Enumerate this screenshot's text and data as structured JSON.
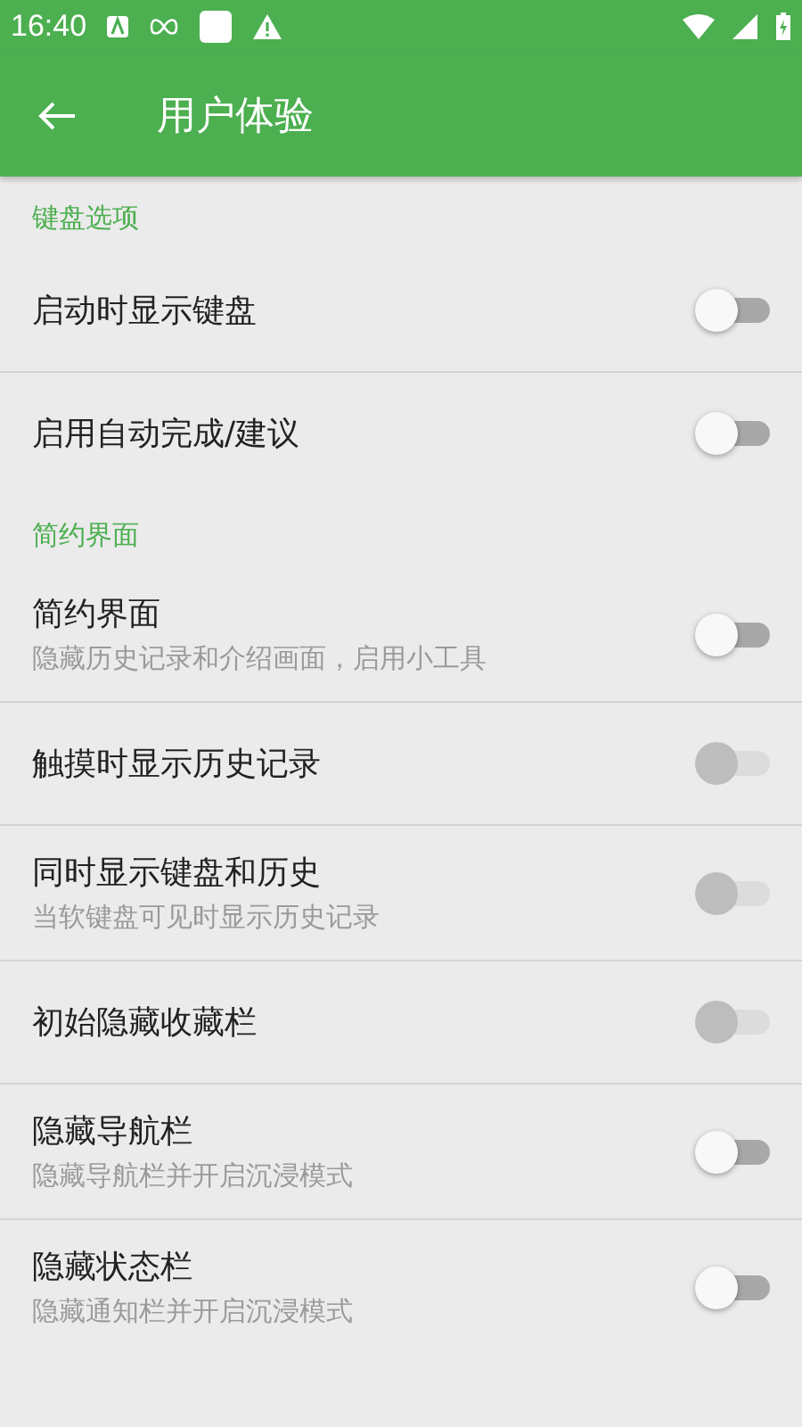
{
  "status_bar": {
    "time": "16:40"
  },
  "toolbar": {
    "title": "用户体验"
  },
  "sections": [
    {
      "header": "键盘选项",
      "items": [
        {
          "title": "启动时显示键盘",
          "on": false,
          "disabled": false
        },
        {
          "title": "启用自动完成/建议",
          "on": false,
          "disabled": false
        }
      ]
    },
    {
      "header": "简约界面",
      "items": [
        {
          "title": "简约界面",
          "summary": "隐藏历史记录和介绍画面，启用小工具",
          "on": false,
          "disabled": false
        },
        {
          "title": "触摸时显示历史记录",
          "on": false,
          "disabled": true
        },
        {
          "title": "同时显示键盘和历史",
          "summary": "当软键盘可见时显示历史记录",
          "on": false,
          "disabled": true
        },
        {
          "title": "初始隐藏收藏栏",
          "on": false,
          "disabled": true
        },
        {
          "title": "隐藏导航栏",
          "summary": "隐藏导航栏并开启沉浸模式",
          "on": false,
          "disabled": false
        },
        {
          "title": "隐藏状态栏",
          "summary": "隐藏通知栏并开启沉浸模式",
          "on": false,
          "disabled": false
        }
      ]
    }
  ]
}
